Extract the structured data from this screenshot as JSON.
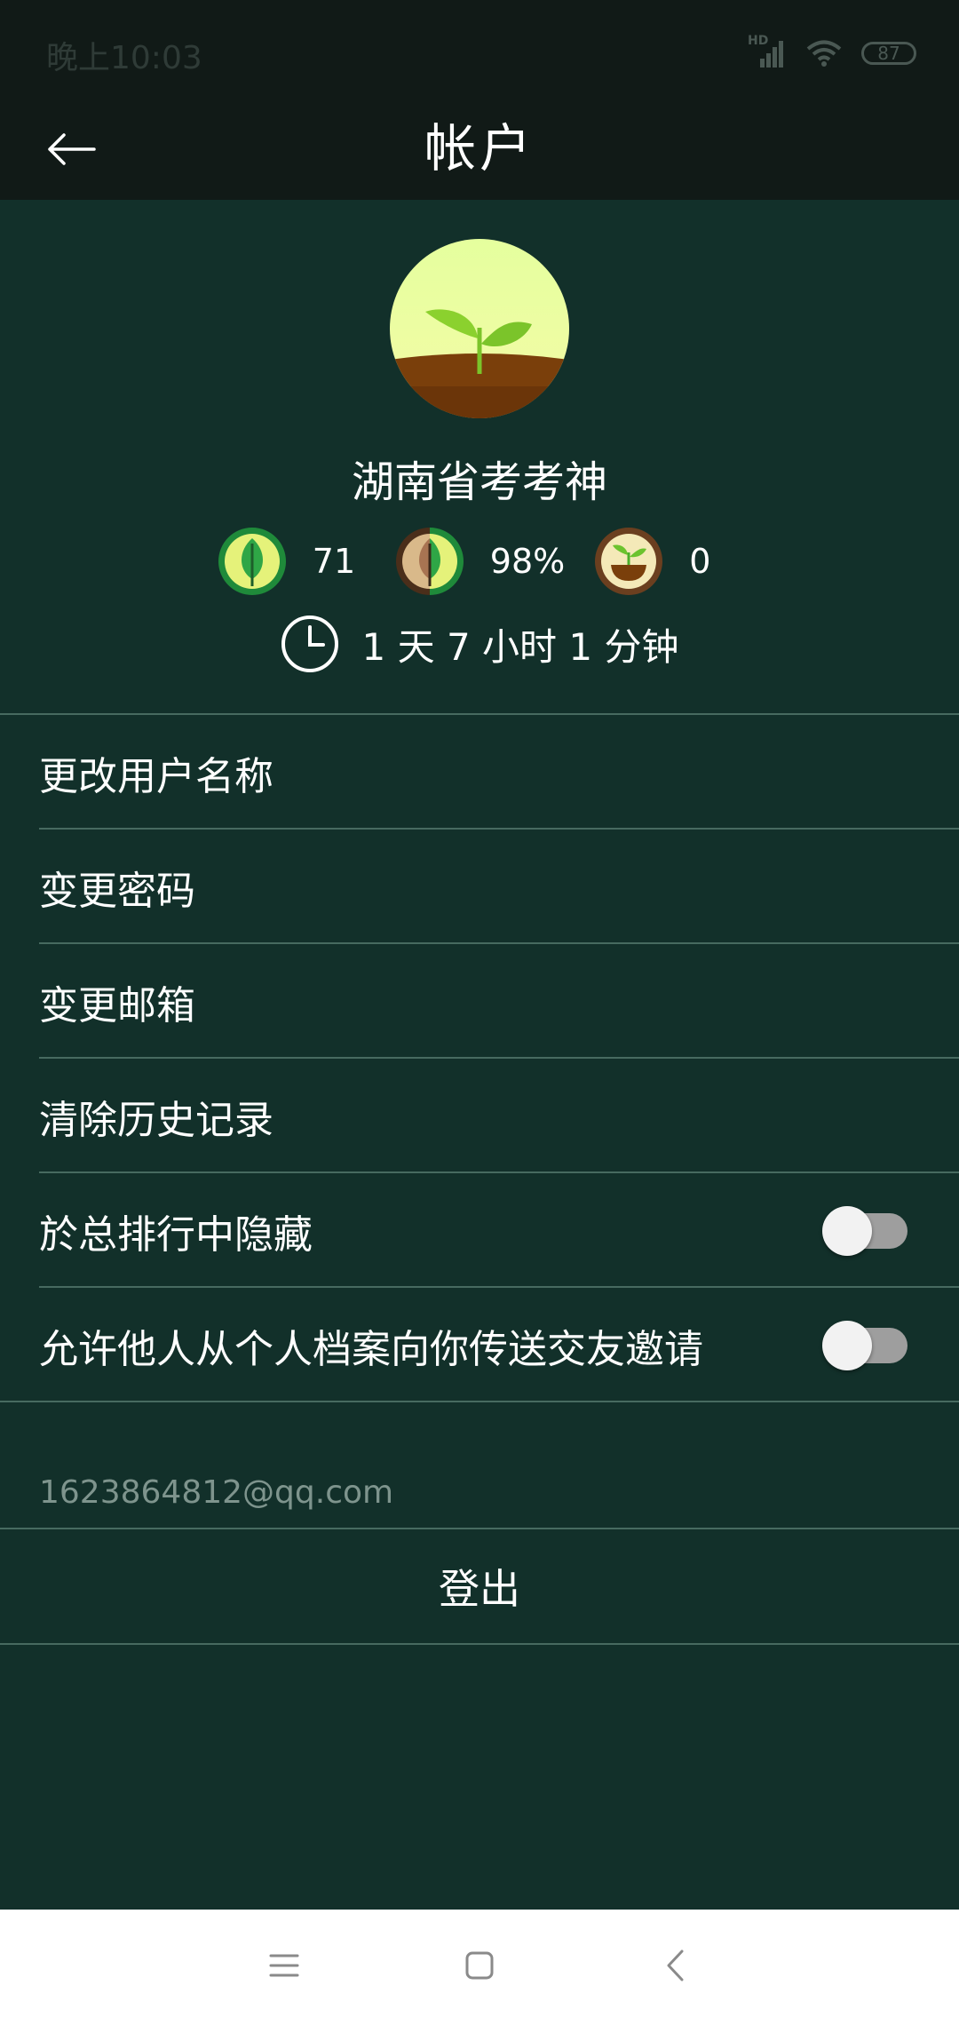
{
  "status_bar": {
    "time": "晚上10:03",
    "network_label": "HD",
    "battery": "87"
  },
  "header": {
    "title": "帐户",
    "back_icon": "arrow-left-icon"
  },
  "profile": {
    "username": "湖南省考考神",
    "stats": [
      {
        "icon": "healthy-tree-icon",
        "value": "71"
      },
      {
        "icon": "half-withered-tree-icon",
        "value": "98%"
      },
      {
        "icon": "seedling-pot-icon",
        "value": "0"
      }
    ],
    "focus_time": "1 天 7 小时 1 分钟"
  },
  "menu": {
    "change_username": "更改用户名称",
    "change_password": "变更密码",
    "change_email": "变更邮箱",
    "clear_history": "清除历史记录",
    "hide_in_leaderboard": "於总排行中隐藏",
    "allow_friend_requests": "允许他人从个人档案向你传送交友邀请"
  },
  "toggles": {
    "hide_in_leaderboard": "off",
    "allow_friend_requests": "off"
  },
  "account": {
    "email": "1623864812@qq.com",
    "logout_label": "登出"
  },
  "colors": {
    "background": "#12302A",
    "header": "#111A17",
    "divider": "#476A60",
    "text": "#FFFFFF",
    "muted_text": "#7E948D"
  }
}
